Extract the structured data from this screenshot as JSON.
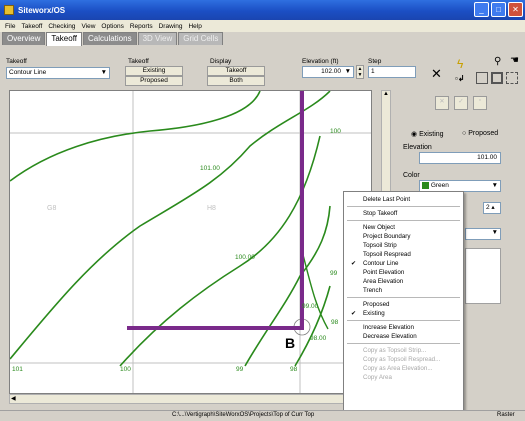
{
  "window": {
    "title": "Siteworx/OS"
  },
  "menu": [
    "File",
    "Takeoff",
    "Checking",
    "View",
    "Options",
    "Reports",
    "Drawing",
    "Help"
  ],
  "tabs": [
    {
      "label": "Overview",
      "state": "inactive"
    },
    {
      "label": "Takeoff",
      "state": "active"
    },
    {
      "label": "Calculations",
      "state": "inactive"
    },
    {
      "label": "3D View",
      "state": "disabled"
    },
    {
      "label": "Grid Cells",
      "state": "disabled"
    }
  ],
  "toolbar": {
    "takeoff_label": "Takeoff",
    "takeoff_value": "Contour Line",
    "takeoff2_label": "Takeoff",
    "existing_btn": "Existing",
    "proposed_btn": "Proposed",
    "display_label": "Display",
    "display_takeoff": "Takeoff",
    "display_both": "Both",
    "elevation_label": "Elevation (ft)",
    "elevation_value": "102.00",
    "step_label": "Step",
    "step_value": "1"
  },
  "drawing": {
    "contour_labels": [
      "101.00",
      "100.00",
      "99.00",
      "98.00",
      "100",
      "99",
      "98",
      "101",
      "100",
      "99",
      "98"
    ],
    "grid_labels": [
      "G8",
      "H8"
    ],
    "point_label": "B"
  },
  "panel": {
    "existing_label": "Existing",
    "proposed_label": "Proposed",
    "selected_option": "Existing",
    "elevation_label": "Elevation",
    "elevation_value": "101.00",
    "color_label": "Color",
    "color_value": "Green",
    "spin_value": "2"
  },
  "context_menu": {
    "items": [
      {
        "label": "Delete Last Point",
        "checked": false,
        "disabled": false
      },
      {
        "label": "Stop Takeoff",
        "checked": false,
        "disabled": false
      },
      {
        "label": "New Object",
        "checked": false,
        "disabled": false
      },
      {
        "label": "Project Boundary",
        "checked": false,
        "disabled": false
      },
      {
        "label": "Topsoil Strip",
        "checked": false,
        "disabled": false
      },
      {
        "label": "Topsoil Respread",
        "checked": false,
        "disabled": false
      },
      {
        "label": "Contour Line",
        "checked": true,
        "disabled": false
      },
      {
        "label": "Point Elevation",
        "checked": false,
        "disabled": false
      },
      {
        "label": "Area Elevation",
        "checked": false,
        "disabled": false
      },
      {
        "label": "Trench",
        "checked": false,
        "disabled": false
      },
      {
        "label": "Proposed",
        "checked": false,
        "disabled": false
      },
      {
        "label": "Existing",
        "checked": true,
        "disabled": false
      },
      {
        "label": "Increase Elevation",
        "checked": false,
        "disabled": false
      },
      {
        "label": "Decrease Elevation",
        "checked": false,
        "disabled": false
      },
      {
        "label": "Copy as Topsoil Strip...",
        "checked": false,
        "disabled": true
      },
      {
        "label": "Copy as Topsoil Respread...",
        "checked": false,
        "disabled": true
      },
      {
        "label": "Copy as Area Elevation...",
        "checked": false,
        "disabled": true
      },
      {
        "label": "Copy Area",
        "checked": false,
        "disabled": true
      }
    ]
  },
  "statusbar": {
    "path": "C:\\...\\Vertigraph\\SiteWorxOS\\Projects\\Top of Curr Top",
    "mode": "Raster"
  },
  "colors": {
    "contour": "#2a8a1c",
    "takeoff_line": "#7a2a8a",
    "titlebar": "#1b4fc4"
  }
}
